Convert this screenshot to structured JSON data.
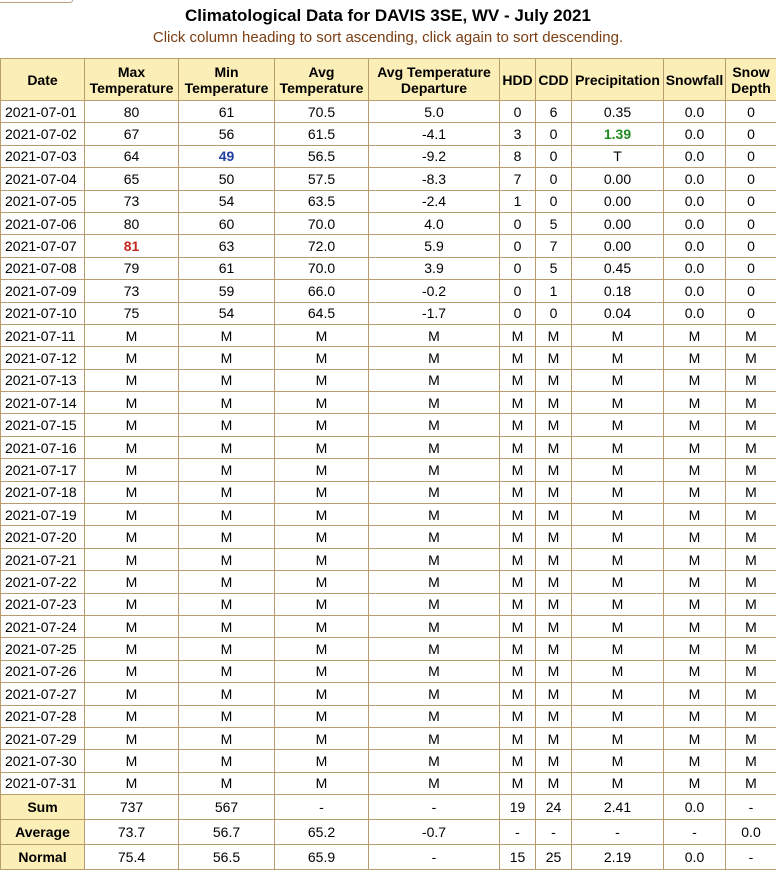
{
  "title": "Climatological Data for DAVIS 3SE, WV - July 2021",
  "subtitle": "Click column heading to sort ascending, click again to sort descending.",
  "headers": {
    "date": "Date",
    "max_1": "Max",
    "max_2": "Temperature",
    "min_1": "Min",
    "min_2": "Temperature",
    "avg_1": "Avg",
    "avg_2": "Temperature",
    "dep_1": "Avg Temperature",
    "dep_2": "Departure",
    "hdd": "HDD",
    "cdd": "CDD",
    "precip": "Precipitation",
    "snowfall": "Snowfall",
    "snowd_1": "Snow",
    "snowd_2": "Depth"
  },
  "rows": [
    {
      "date": "2021-07-01",
      "max": "80",
      "min": "61",
      "avg": "70.5",
      "dep": "5.0",
      "hdd": "0",
      "cdd": "6",
      "precip": "0.35",
      "snowfall": "0.0",
      "snowd": "0"
    },
    {
      "date": "2021-07-02",
      "max": "67",
      "min": "56",
      "avg": "61.5",
      "dep": "-4.1",
      "hdd": "3",
      "cdd": "0",
      "precip": "1.39",
      "snowfall": "0.0",
      "snowd": "0"
    },
    {
      "date": "2021-07-03",
      "max": "64",
      "min": "49",
      "avg": "56.5",
      "dep": "-9.2",
      "hdd": "8",
      "cdd": "0",
      "precip": "T",
      "snowfall": "0.0",
      "snowd": "0"
    },
    {
      "date": "2021-07-04",
      "max": "65",
      "min": "50",
      "avg": "57.5",
      "dep": "-8.3",
      "hdd": "7",
      "cdd": "0",
      "precip": "0.00",
      "snowfall": "0.0",
      "snowd": "0"
    },
    {
      "date": "2021-07-05",
      "max": "73",
      "min": "54",
      "avg": "63.5",
      "dep": "-2.4",
      "hdd": "1",
      "cdd": "0",
      "precip": "0.00",
      "snowfall": "0.0",
      "snowd": "0"
    },
    {
      "date": "2021-07-06",
      "max": "80",
      "min": "60",
      "avg": "70.0",
      "dep": "4.0",
      "hdd": "0",
      "cdd": "5",
      "precip": "0.00",
      "snowfall": "0.0",
      "snowd": "0"
    },
    {
      "date": "2021-07-07",
      "max": "81",
      "min": "63",
      "avg": "72.0",
      "dep": "5.9",
      "hdd": "0",
      "cdd": "7",
      "precip": "0.00",
      "snowfall": "0.0",
      "snowd": "0"
    },
    {
      "date": "2021-07-08",
      "max": "79",
      "min": "61",
      "avg": "70.0",
      "dep": "3.9",
      "hdd": "0",
      "cdd": "5",
      "precip": "0.45",
      "snowfall": "0.0",
      "snowd": "0"
    },
    {
      "date": "2021-07-09",
      "max": "73",
      "min": "59",
      "avg": "66.0",
      "dep": "-0.2",
      "hdd": "0",
      "cdd": "1",
      "precip": "0.18",
      "snowfall": "0.0",
      "snowd": "0"
    },
    {
      "date": "2021-07-10",
      "max": "75",
      "min": "54",
      "avg": "64.5",
      "dep": "-1.7",
      "hdd": "0",
      "cdd": "0",
      "precip": "0.04",
      "snowfall": "0.0",
      "snowd": "0"
    },
    {
      "date": "2021-07-11",
      "max": "M",
      "min": "M",
      "avg": "M",
      "dep": "M",
      "hdd": "M",
      "cdd": "M",
      "precip": "M",
      "snowfall": "M",
      "snowd": "M"
    },
    {
      "date": "2021-07-12",
      "max": "M",
      "min": "M",
      "avg": "M",
      "dep": "M",
      "hdd": "M",
      "cdd": "M",
      "precip": "M",
      "snowfall": "M",
      "snowd": "M"
    },
    {
      "date": "2021-07-13",
      "max": "M",
      "min": "M",
      "avg": "M",
      "dep": "M",
      "hdd": "M",
      "cdd": "M",
      "precip": "M",
      "snowfall": "M",
      "snowd": "M"
    },
    {
      "date": "2021-07-14",
      "max": "M",
      "min": "M",
      "avg": "M",
      "dep": "M",
      "hdd": "M",
      "cdd": "M",
      "precip": "M",
      "snowfall": "M",
      "snowd": "M"
    },
    {
      "date": "2021-07-15",
      "max": "M",
      "min": "M",
      "avg": "M",
      "dep": "M",
      "hdd": "M",
      "cdd": "M",
      "precip": "M",
      "snowfall": "M",
      "snowd": "M"
    },
    {
      "date": "2021-07-16",
      "max": "M",
      "min": "M",
      "avg": "M",
      "dep": "M",
      "hdd": "M",
      "cdd": "M",
      "precip": "M",
      "snowfall": "M",
      "snowd": "M"
    },
    {
      "date": "2021-07-17",
      "max": "M",
      "min": "M",
      "avg": "M",
      "dep": "M",
      "hdd": "M",
      "cdd": "M",
      "precip": "M",
      "snowfall": "M",
      "snowd": "M"
    },
    {
      "date": "2021-07-18",
      "max": "M",
      "min": "M",
      "avg": "M",
      "dep": "M",
      "hdd": "M",
      "cdd": "M",
      "precip": "M",
      "snowfall": "M",
      "snowd": "M"
    },
    {
      "date": "2021-07-19",
      "max": "M",
      "min": "M",
      "avg": "M",
      "dep": "M",
      "hdd": "M",
      "cdd": "M",
      "precip": "M",
      "snowfall": "M",
      "snowd": "M"
    },
    {
      "date": "2021-07-20",
      "max": "M",
      "min": "M",
      "avg": "M",
      "dep": "M",
      "hdd": "M",
      "cdd": "M",
      "precip": "M",
      "snowfall": "M",
      "snowd": "M"
    },
    {
      "date": "2021-07-21",
      "max": "M",
      "min": "M",
      "avg": "M",
      "dep": "M",
      "hdd": "M",
      "cdd": "M",
      "precip": "M",
      "snowfall": "M",
      "snowd": "M"
    },
    {
      "date": "2021-07-22",
      "max": "M",
      "min": "M",
      "avg": "M",
      "dep": "M",
      "hdd": "M",
      "cdd": "M",
      "precip": "M",
      "snowfall": "M",
      "snowd": "M"
    },
    {
      "date": "2021-07-23",
      "max": "M",
      "min": "M",
      "avg": "M",
      "dep": "M",
      "hdd": "M",
      "cdd": "M",
      "precip": "M",
      "snowfall": "M",
      "snowd": "M"
    },
    {
      "date": "2021-07-24",
      "max": "M",
      "min": "M",
      "avg": "M",
      "dep": "M",
      "hdd": "M",
      "cdd": "M",
      "precip": "M",
      "snowfall": "M",
      "snowd": "M"
    },
    {
      "date": "2021-07-25",
      "max": "M",
      "min": "M",
      "avg": "M",
      "dep": "M",
      "hdd": "M",
      "cdd": "M",
      "precip": "M",
      "snowfall": "M",
      "snowd": "M"
    },
    {
      "date": "2021-07-26",
      "max": "M",
      "min": "M",
      "avg": "M",
      "dep": "M",
      "hdd": "M",
      "cdd": "M",
      "precip": "M",
      "snowfall": "M",
      "snowd": "M"
    },
    {
      "date": "2021-07-27",
      "max": "M",
      "min": "M",
      "avg": "M",
      "dep": "M",
      "hdd": "M",
      "cdd": "M",
      "precip": "M",
      "snowfall": "M",
      "snowd": "M"
    },
    {
      "date": "2021-07-28",
      "max": "M",
      "min": "M",
      "avg": "M",
      "dep": "M",
      "hdd": "M",
      "cdd": "M",
      "precip": "M",
      "snowfall": "M",
      "snowd": "M"
    },
    {
      "date": "2021-07-29",
      "max": "M",
      "min": "M",
      "avg": "M",
      "dep": "M",
      "hdd": "M",
      "cdd": "M",
      "precip": "M",
      "snowfall": "M",
      "snowd": "M"
    },
    {
      "date": "2021-07-30",
      "max": "M",
      "min": "M",
      "avg": "M",
      "dep": "M",
      "hdd": "M",
      "cdd": "M",
      "precip": "M",
      "snowfall": "M",
      "snowd": "M"
    },
    {
      "date": "2021-07-31",
      "max": "M",
      "min": "M",
      "avg": "M",
      "dep": "M",
      "hdd": "M",
      "cdd": "M",
      "precip": "M",
      "snowfall": "M",
      "snowd": "M"
    }
  ],
  "highlights": [
    {
      "row": 6,
      "col": "max",
      "style": "hi"
    },
    {
      "row": 2,
      "col": "min",
      "style": "lo"
    },
    {
      "row": 1,
      "col": "precip",
      "style": "wet"
    }
  ],
  "summary": [
    {
      "label": "Sum",
      "max": "737",
      "min": "567",
      "avg": "-",
      "dep": "-",
      "hdd": "19",
      "cdd": "24",
      "precip": "2.41",
      "snowfall": "0.0",
      "snowd": "-"
    },
    {
      "label": "Average",
      "max": "73.7",
      "min": "56.7",
      "avg": "65.2",
      "dep": "-0.7",
      "hdd": "-",
      "cdd": "-",
      "precip": "-",
      "snowfall": "-",
      "snowd": "0.0"
    },
    {
      "label": "Normal",
      "max": "75.4",
      "min": "56.5",
      "avg": "65.9",
      "dep": "-",
      "hdd": "15",
      "cdd": "25",
      "precip": "2.19",
      "snowfall": "0.0",
      "snowd": "-"
    }
  ],
  "colors": {
    "header_bg": "#fbeeb6",
    "border": "#b69c6e",
    "subtitle": "#7a3e12",
    "record_high": "#c2281e",
    "record_low": "#1f3fa0",
    "max_precip": "#1f8a1f"
  }
}
